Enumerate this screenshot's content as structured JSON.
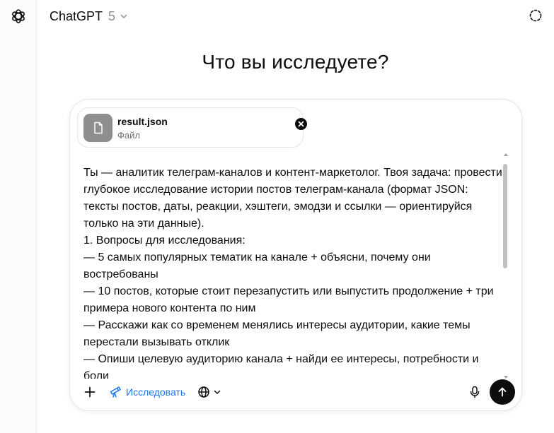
{
  "header": {
    "model_name": "ChatGPT",
    "model_version": "5"
  },
  "main": {
    "title": "Что вы исследуете?"
  },
  "composer": {
    "attachment": {
      "file_name": "result.json",
      "file_type": "Файл"
    },
    "prompt_lines": [
      "Ты — аналитик телеграм-каналов и контент-маркетолог. Твоя задача: провести глубокое исследование истории постов телеграм-канала (формат JSON: тексты постов, даты, реакции, хэштеги, эмодзи и ссылки — ориентируйся только на эти данные).",
      "1. Вопросы для исследования:",
      "— 5 самых популярных тематик на канале + объясни, почему они востребованы",
      "— 10 постов, которые стоит перезапустить или выпустить продолжение + три примера нового контента по ним",
      "— Расскажи как со временем менялись интересы аудитории, какие темы перестали вызывать отклик",
      "— Опиши целевую аудиторию канала + найди ее интересы, потребности и боли"
    ],
    "research_label": "Исследовать"
  },
  "icons": {
    "logo": "openai-logo-icon",
    "model_chevron": "chevron-down-icon",
    "temporary_chat": "dashed-circle-icon",
    "file": "file-icon",
    "remove": "close-icon",
    "plus": "plus-icon",
    "research": "telescope-icon",
    "web": "globe-icon",
    "web_chevron": "chevron-down-icon",
    "mic": "microphone-icon",
    "send": "arrow-up-icon"
  },
  "colors": {
    "accent_blue": "#1d74e8",
    "send_button": "#0d0d0d",
    "file_thumb": "#8e8e8e"
  }
}
